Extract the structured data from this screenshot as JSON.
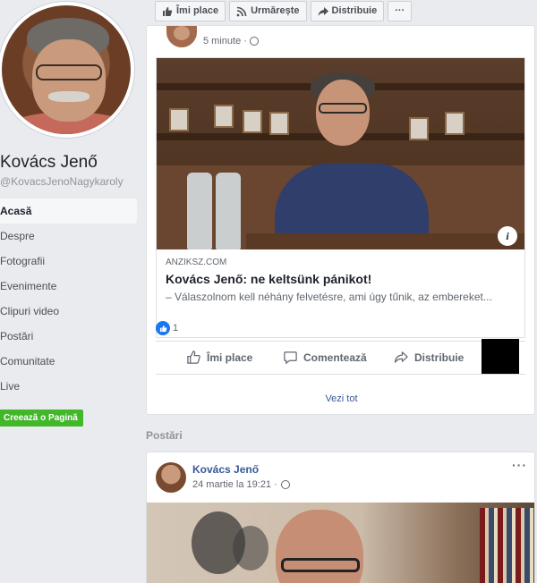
{
  "sidebar": {
    "page_name": "Kovács Jenő",
    "handle": "@KovacsJenoNagykaroly",
    "nav": [
      "Acasă",
      "Despre",
      "Fotografii",
      "Evenimente",
      "Clipuri video",
      "Postări",
      "Comunitate",
      "Live"
    ],
    "create_page": "Creează o Pagină"
  },
  "top_actions": {
    "like": "Îmi place",
    "follow": "Urmărește",
    "share": "Distribuie",
    "more": "···"
  },
  "featured_post": {
    "timestamp": "5 minute ·",
    "link": {
      "domain": "ANZIKSZ.COM",
      "title": "Kovács Jenő: ne keltsünk pánikot!",
      "description": "– Válaszolnom kell néhány felvetésre, ami úgy tűnik, az embereket..."
    },
    "reaction_count": "1",
    "actions": {
      "like": "Îmi place",
      "comment": "Comentează",
      "share": "Distribuie"
    },
    "see_all": "Vezi tot"
  },
  "posts_section": {
    "title": "Postări",
    "post": {
      "author": "Kovács Jenő",
      "timestamp": "24 martie la 19:21 ·",
      "more": "···"
    }
  },
  "colors": {
    "brand_blue": "#385898",
    "like_blue": "#1877f2",
    "create_green": "#42b72a"
  }
}
